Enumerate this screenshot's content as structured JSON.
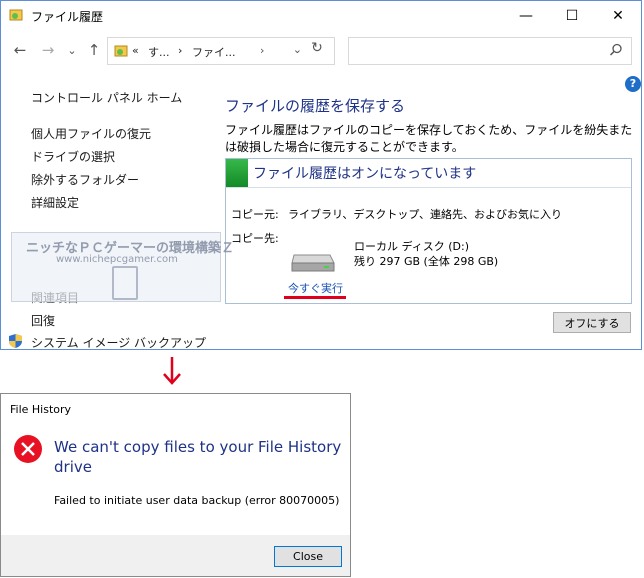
{
  "window": {
    "title": "ファイル履歴",
    "caption": {
      "minimize": "—",
      "maximize": "☐",
      "close": "✕"
    },
    "nav": {
      "back": "←",
      "forward": "→",
      "recent": "⌄",
      "up": "↑"
    },
    "address": {
      "back_chevron": "«",
      "segment1": "す...",
      "sep1": "›",
      "segment2": "ファイ...",
      "sep2": "›",
      "dropdown": "⌄",
      "refresh": "↻"
    },
    "help": "?"
  },
  "sidebar": {
    "home": "コントロール パネル ホーム",
    "links": [
      "個人用ファイルの復元",
      "ドライブの選択",
      "除外するフォルダー",
      "詳細設定"
    ],
    "related_heading": "関連項目",
    "related": [
      "回復",
      "システム イメージ バックアップ"
    ]
  },
  "main": {
    "title": "ファイルの履歴を保存する",
    "description": "ファイル履歴はファイルのコピーを保存しておくため、ファイルを紛失または破損した場合に復元することができます。",
    "panel": {
      "title": "ファイル履歴はオンになっています",
      "source_label": "コピー元:",
      "source_value": "ライブラリ、デスクトップ、連絡先、およびお気に入り",
      "dest_label": "コピー先:",
      "drive_name": "ローカル ディスク (D:)",
      "drive_space": "残り 297 GB (全体 298 GB)",
      "run_now": "今すぐ実行"
    },
    "off_button": "オフにする"
  },
  "watermark": {
    "line1": "ニッチなＰＣゲーマーの環境構築Ｚ",
    "line2": "www.nichepcgamer.com"
  },
  "dialog": {
    "title": "File History",
    "message": "We can't copy files to your File History drive",
    "detail": "Failed to initiate user data backup (error 80070005)",
    "close_label": "Close"
  },
  "colors": {
    "heading_blue": "#1e3287",
    "link_blue": "#1450b4",
    "annotation_red": "#e0001b",
    "status_green": "#138a27",
    "error_red": "#e81123"
  }
}
